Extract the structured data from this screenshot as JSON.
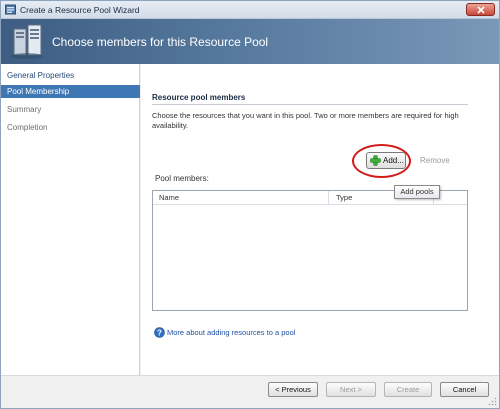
{
  "window": {
    "title": "Create a Resource Pool Wizard",
    "close_icon": "close-icon",
    "app_icon": "wizard-app-icon"
  },
  "banner": {
    "title": "Choose members for this Resource Pool",
    "icon": "servers-icon"
  },
  "sidebar": {
    "items": [
      {
        "label": "General Properties",
        "state": "done"
      },
      {
        "label": "Pool Membership",
        "state": "active"
      },
      {
        "label": "Summary",
        "state": "pending"
      },
      {
        "label": "Completion",
        "state": "pending"
      }
    ]
  },
  "content": {
    "section_title": "Resource pool members",
    "description": "Choose the resources that you want in this pool. Two or more members are required for high availability.",
    "add_button": "Add...",
    "remove_button": "Remove",
    "tooltip": "Add pools",
    "members_label": "Pool members:",
    "columns": [
      "Name",
      "Type"
    ],
    "rows": [],
    "help_link": "More about adding resources to a pool"
  },
  "footer": {
    "previous": "< Previous",
    "next": "Next >",
    "create": "Create",
    "cancel": "Cancel"
  },
  "colors": {
    "highlight_ring": "#d41a17",
    "active_nav": "#3f77b4",
    "banner": "#3d5d82",
    "link": "#1d4f9f"
  }
}
